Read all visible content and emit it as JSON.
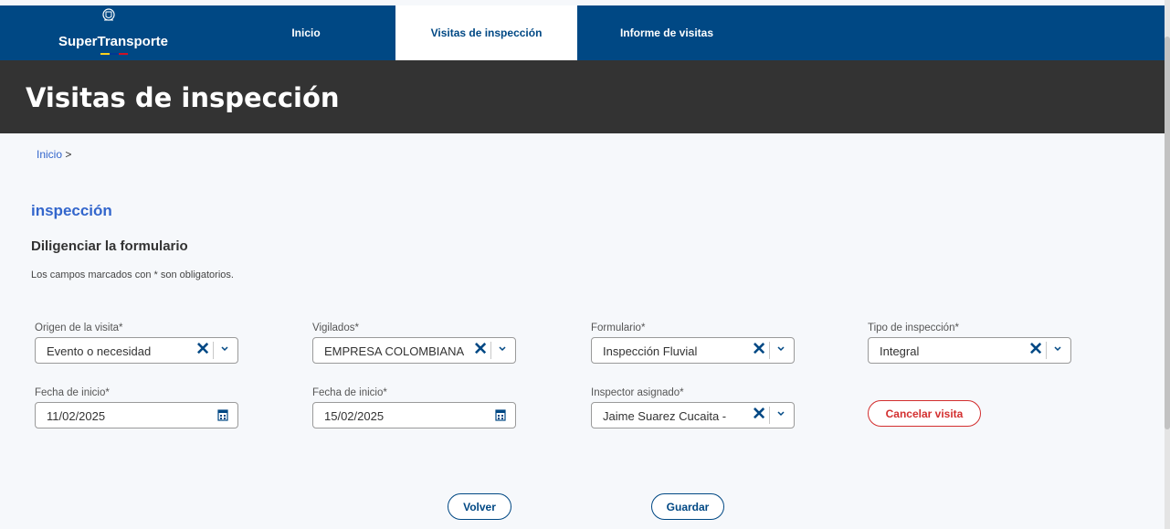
{
  "header": {
    "brand": "SuperTransporte",
    "nav": [
      {
        "label": "Inicio",
        "active": false
      },
      {
        "label": "Visitas de inspección",
        "active": true
      },
      {
        "label": "Informe de visitas",
        "active": false
      }
    ]
  },
  "page_title": "Visitas de inspección",
  "breadcrumb": {
    "link": "Inicio",
    "separator": ">"
  },
  "section_title": "inspección",
  "form": {
    "title": "Diligenciar la formulario",
    "note": "Los campos marcados con * son obligatorios.",
    "fields": {
      "origen": {
        "label": "Origen de la visita*",
        "value": "Evento o necesidad"
      },
      "vigilados": {
        "label": "Vigilados*",
        "value": "EMPRESA COLOMBIANA"
      },
      "formulario": {
        "label": "Formulario*",
        "value": "Inspección Fluvial"
      },
      "tipo": {
        "label": "Tipo de inspección*",
        "value": "Integral"
      },
      "fecha1": {
        "label": "Fecha de inicio*",
        "value": "11/02/2025"
      },
      "fecha2": {
        "label": "Fecha de inicio*",
        "value": "15/02/2025"
      },
      "inspector": {
        "label": "Inspector asignado*",
        "value": "Jaime Suarez Cucaita -"
      }
    },
    "cancel_label": "Cancelar visita",
    "back_label": "Volver",
    "save_label": "Guardar"
  },
  "icons": {
    "clear": "close-x-icon",
    "dropdown": "chevron-down-icon",
    "date": "calendar-icon"
  },
  "colors": {
    "primary": "#004884",
    "link": "#3366cc",
    "danger": "#d32f2f",
    "title_bar": "#333333"
  }
}
